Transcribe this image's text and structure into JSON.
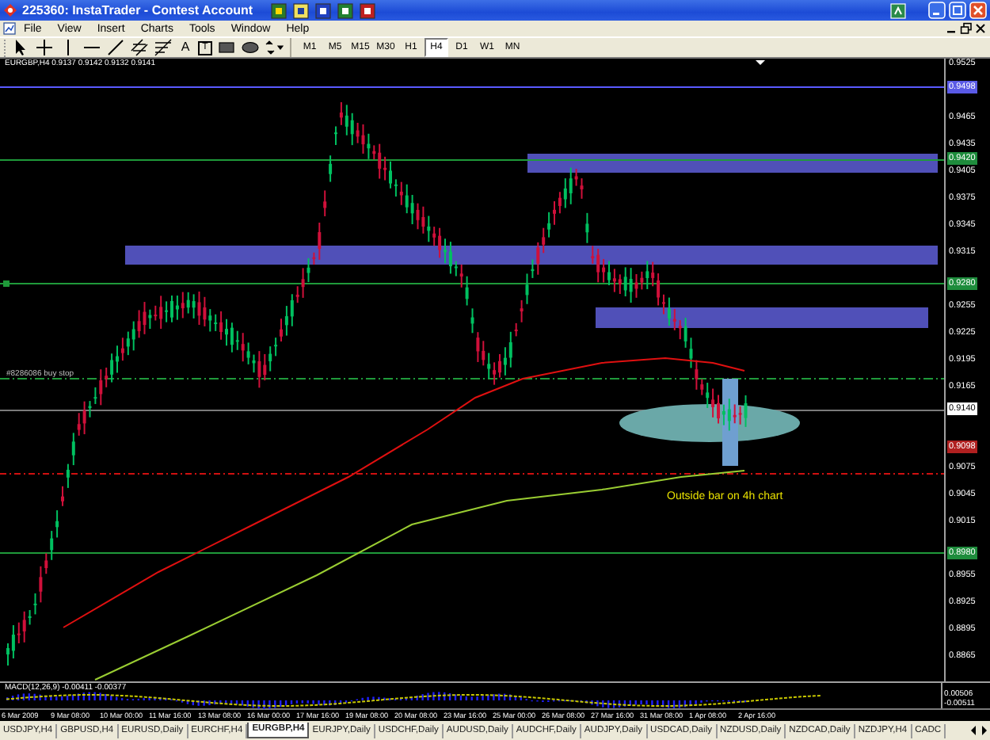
{
  "window": {
    "title": "225360: InstaTrader - Contest Account"
  },
  "menu": [
    "File",
    "View",
    "Insert",
    "Charts",
    "Tools",
    "Window",
    "Help"
  ],
  "toolbar": {
    "tools": [
      {
        "kind": "cursor"
      },
      {
        "kind": "crosshair"
      },
      {
        "kind": "vline"
      },
      {
        "kind": "hline"
      },
      {
        "kind": "trendline"
      },
      {
        "kind": "channel"
      },
      {
        "kind": "fibo"
      },
      {
        "kind": "text",
        "label": "A"
      },
      {
        "kind": "label",
        "label": "T"
      },
      {
        "kind": "rect"
      },
      {
        "kind": "ellipse"
      },
      {
        "kind": "arrows"
      }
    ],
    "timeframes": [
      {
        "label": "M1",
        "selected": false
      },
      {
        "label": "M5",
        "selected": false
      },
      {
        "label": "M15",
        "selected": false
      },
      {
        "label": "M30",
        "selected": false
      },
      {
        "label": "H1",
        "selected": false
      },
      {
        "label": "H4",
        "selected": true
      },
      {
        "label": "D1",
        "selected": false
      },
      {
        "label": "W1",
        "selected": false
      },
      {
        "label": "MN",
        "selected": false
      }
    ]
  },
  "chart": {
    "header": "EURGBP,H4  0.9137 0.9142 0.9132 0.9141",
    "order_label": "#8286086 buy stop",
    "annotation": "Outside bar on 4h chart",
    "price_axis": [
      {
        "text": "0.9525",
        "kind": "tick"
      },
      {
        "text": "0.9498",
        "kind": "marker",
        "color": "#5a5ae6"
      },
      {
        "text": "0.9465",
        "kind": "tick"
      },
      {
        "text": "0.9435",
        "kind": "tick"
      },
      {
        "text": "0.9420",
        "kind": "marker",
        "color": "#1e8c3c"
      },
      {
        "text": "0.9405",
        "kind": "tick"
      },
      {
        "text": "0.9375",
        "kind": "tick"
      },
      {
        "text": "0.9345",
        "kind": "tick"
      },
      {
        "text": "0.9315",
        "kind": "tick"
      },
      {
        "text": "0.9280",
        "kind": "marker",
        "color": "#1e8c3c"
      },
      {
        "text": "0.9255",
        "kind": "tick"
      },
      {
        "text": "0.9225",
        "kind": "tick"
      },
      {
        "text": "0.9195",
        "kind": "tick"
      },
      {
        "text": "0.9165",
        "kind": "tick"
      },
      {
        "text": "0.9140",
        "kind": "marker",
        "color": "#ffffff"
      },
      {
        "text": "0.9098",
        "kind": "marker",
        "color": "#b02020"
      },
      {
        "text": "0.9075",
        "kind": "tick"
      },
      {
        "text": "0.9045",
        "kind": "tick"
      },
      {
        "text": "0.9015",
        "kind": "tick"
      },
      {
        "text": "0.8980",
        "kind": "marker",
        "color": "#1e8c3c"
      },
      {
        "text": "0.8955",
        "kind": "tick"
      },
      {
        "text": "0.8925",
        "kind": "tick"
      },
      {
        "text": "0.8895",
        "kind": "tick"
      },
      {
        "text": "0.8865",
        "kind": "tick"
      }
    ],
    "time_axis": [
      "6 Mar 2009",
      "9 Mar 08:00",
      "10 Mar 00:00",
      "11 Mar 16:00",
      "13 Mar 08:00",
      "16 Mar 00:00",
      "17 Mar 16:00",
      "19 Mar 08:00",
      "20 Mar 08:00",
      "23 Mar 16:00",
      "25 Mar 00:00",
      "26 Mar 08:00",
      "27 Mar 16:00",
      "31 Mar 08:00",
      "1 Apr 08:00",
      "2 Apr 16:00"
    ],
    "indicator": {
      "label": "MACD(12,26,9) -0.00411 -0.00377",
      "axis": [
        "0.00506",
        "-0.00511"
      ]
    }
  },
  "tabs": [
    {
      "label": "USDJPY,H4",
      "selected": false
    },
    {
      "label": "GBPUSD,H4",
      "selected": false
    },
    {
      "label": "EURUSD,Daily",
      "selected": false
    },
    {
      "label": "EURCHF,H4",
      "selected": false
    },
    {
      "label": "EURGBP,H4",
      "selected": true
    },
    {
      "label": "EURJPY,Daily",
      "selected": false
    },
    {
      "label": "USDCHF,Daily",
      "selected": false
    },
    {
      "label": "AUDUSD,Daily",
      "selected": false
    },
    {
      "label": "AUDCHF,Daily",
      "selected": false
    },
    {
      "label": "AUDJPY,Daily",
      "selected": false
    },
    {
      "label": "USDCAD,Daily",
      "selected": false
    },
    {
      "label": "NZDUSD,Daily",
      "selected": false
    },
    {
      "label": "NZDCAD,Daily",
      "selected": false
    },
    {
      "label": "NZDJPY,H4",
      "selected": false
    },
    {
      "label": "CADC",
      "selected": false
    }
  ]
}
